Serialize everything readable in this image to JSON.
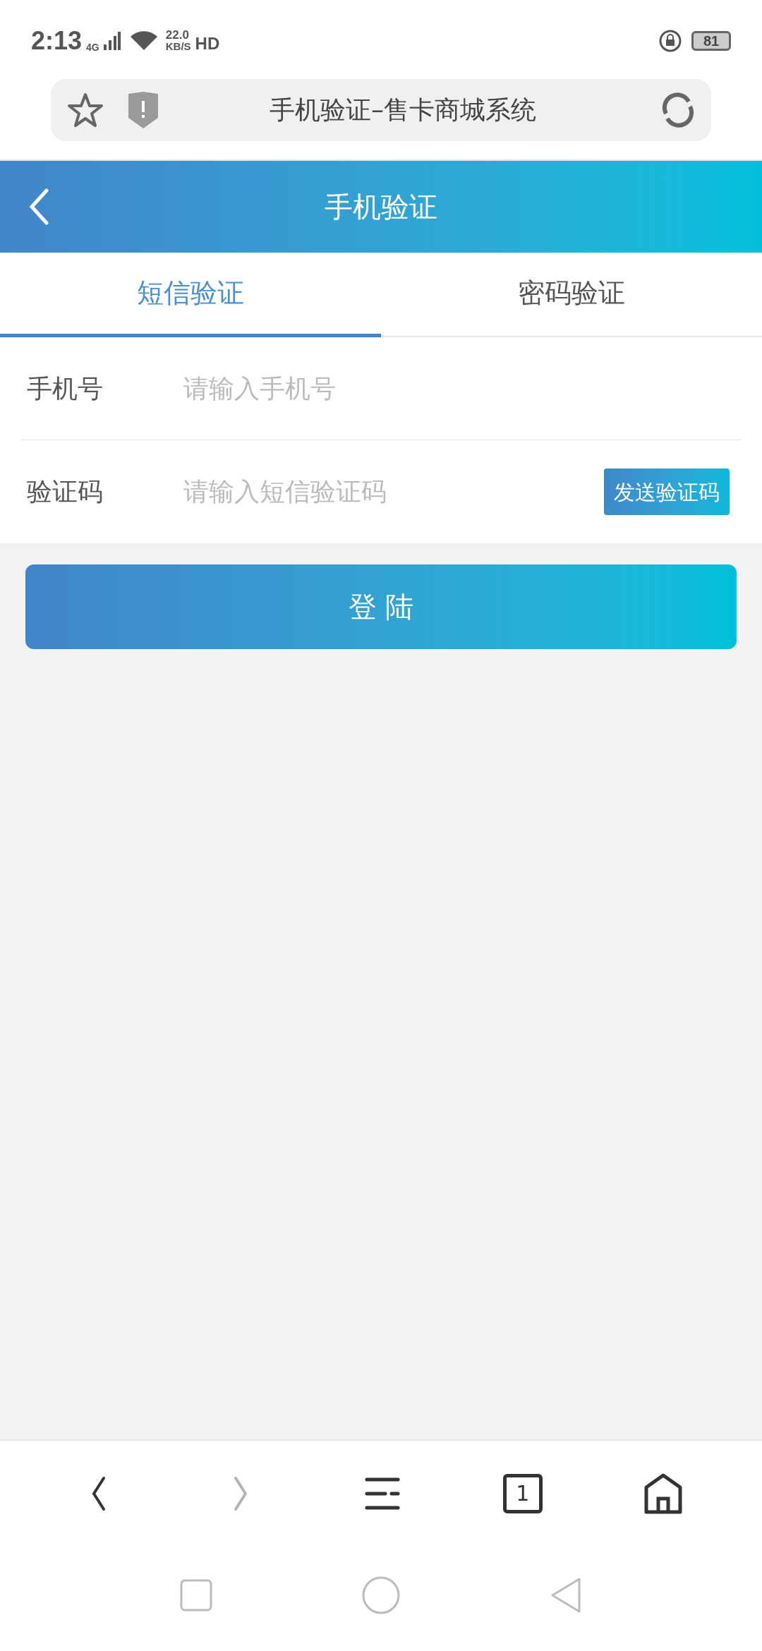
{
  "status_bar": {
    "time": "2:13",
    "network": "4G",
    "speed": "22.0",
    "speed_unit": "KB/S",
    "hd": "HD",
    "battery": "81"
  },
  "browser": {
    "title": "手机验证–售卡商城系统"
  },
  "header": {
    "title": "手机验证"
  },
  "tabs": [
    {
      "label": "短信验证",
      "selected": true
    },
    {
      "label": "密码验证",
      "selected": false
    }
  ],
  "fields": [
    {
      "label": "手机号",
      "placeholder": "请输入手机号"
    },
    {
      "label": "验证码",
      "placeholder": "请输入短信验证码",
      "button": "发送验证码"
    }
  ],
  "login_button": "登 陆",
  "browser_nav": [
    {
      "kind": "back",
      "disabled": false
    },
    {
      "kind": "forward",
      "disabled": true
    },
    {
      "kind": "menu",
      "disabled": false
    },
    {
      "kind": "tabs",
      "count": "1",
      "disabled": false
    },
    {
      "kind": "home",
      "disabled": false
    }
  ]
}
